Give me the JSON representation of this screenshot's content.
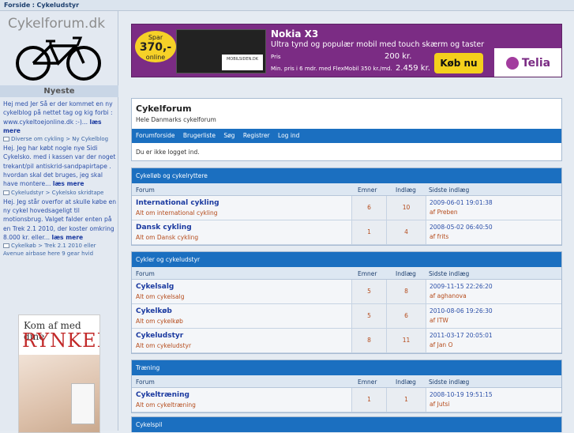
{
  "breadcrumb": {
    "home": "Forside",
    "sep": ":",
    "current": "Cykeludstyr"
  },
  "sidebar": {
    "logo_text": "Cykelforum.dk",
    "latest_heading": "Nyeste",
    "news": [
      {
        "text": "Hej med Jer Så er der kommet en ny cykelblog på nettet tag og kig forbi : www.cykeltoejonline.dk :-)...",
        "more": "læs mere",
        "meta": "Diverse om cykling > Ny Cykelblog"
      },
      {
        "text": "Hej. Jeg har købt nogle nye Sidi Cykelsko. med i kassen var der noget trekant/pil antiskrid-sandpapirtape . hvordan skal det bruges, jeg skal have montere...",
        "more": "læs mere",
        "meta": "Cykeludstyr > Cykelsko skridtape"
      },
      {
        "text": "Hej. Jeg står overfor at skulle købe en ny cykel hovedsageligt til motionsbrug. Valget falder enten på en Trek 2.1 2010, der koster omkring 8.000 kr. eller...",
        "more": "læs mere",
        "meta": "Cykelkøb > Trek 2.1 2010 eller Avenue airbase here 9 gear hvid"
      }
    ],
    "side_ad": {
      "line1": "Kom af med dine",
      "line2": "RYNKER"
    }
  },
  "banner": {
    "save_label": "Spar",
    "save_amount": "370,-",
    "save_online": "online",
    "phone_label": "MOBILSIDEN.DK",
    "title": "Nokia X3",
    "subtitle": "Ultra tynd og populær mobil med touch skærm og taster",
    "price_label": "Pris",
    "price": "200 kr.",
    "min_label": "Min. pris i 6 mdr. med FlexMobil 350 kr./md.",
    "min_price": "2.459 kr.",
    "buy_label": "Køb nu",
    "brand": "Telia"
  },
  "forum": {
    "title": "Cykelforum",
    "subtitle": "Hele Danmarks cykelforum",
    "nav": [
      "Forumforside",
      "Brugerliste",
      "Søg",
      "Registrer",
      "Log ind"
    ],
    "login_message": "Du er ikke logget ind."
  },
  "columns": {
    "forum": "Forum",
    "topics": "Emner",
    "posts": "Indlæg",
    "last": "Sidste indlæg"
  },
  "categories": [
    {
      "name": "Cykelløb og cykelryttere",
      "forums": [
        {
          "name": "International cykling",
          "desc": "Alt om international cykling",
          "topics": "6",
          "posts": "10",
          "last_date": "2009-06-01 19:01:38",
          "last_by": "af Preben"
        },
        {
          "name": "Dansk cykling",
          "desc": "Alt om Dansk cykling",
          "topics": "1",
          "posts": "4",
          "last_date": "2008-05-02 06:40:50",
          "last_by": "af frits"
        }
      ]
    },
    {
      "name": "Cykler og cykeludstyr",
      "forums": [
        {
          "name": "Cykelsalg",
          "desc": "Alt om cykelsalg",
          "topics": "5",
          "posts": "8",
          "last_date": "2009-11-15 22:26:20",
          "last_by": "af aghanova"
        },
        {
          "name": "Cykelkøb",
          "desc": "Alt om cykelkøb",
          "topics": "5",
          "posts": "6",
          "last_date": "2010-08-06 19:26:30",
          "last_by": "af ITW"
        },
        {
          "name": "Cykeludstyr",
          "desc": "Alt om cykeludstyr",
          "topics": "8",
          "posts": "11",
          "last_date": "2011-03-17 20:05:01",
          "last_by": "af Jan O"
        }
      ]
    },
    {
      "name": "Træning",
      "forums": [
        {
          "name": "Cykeltræning",
          "desc": "Alt om cykeltræning",
          "topics": "1",
          "posts": "1",
          "last_date": "2008-10-19 19:51:15",
          "last_by": "af Jutsi"
        }
      ]
    },
    {
      "name": "Cykelspil",
      "forums": []
    }
  ]
}
